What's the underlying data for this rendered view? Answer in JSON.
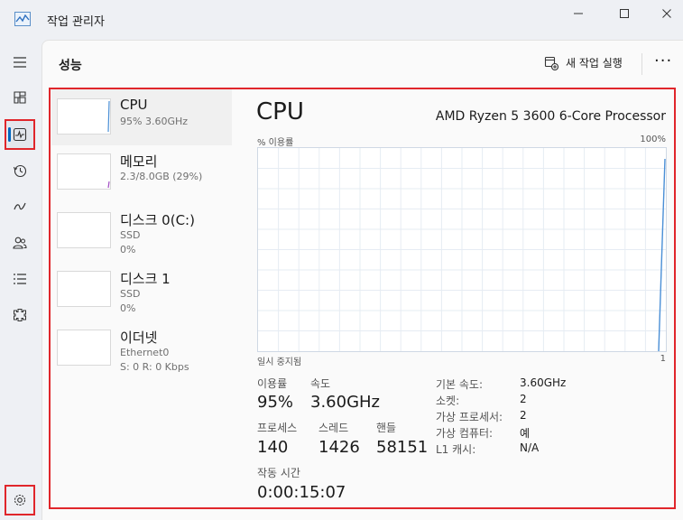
{
  "window": {
    "title": "작업 관리자"
  },
  "page": {
    "title": "성능",
    "run_task_label": "새 작업 실행"
  },
  "nav": [
    "menu-icon",
    "processes-icon",
    "performance-icon",
    "app-history-icon",
    "startup-icon",
    "users-icon",
    "details-icon",
    "services-icon",
    "settings-icon"
  ],
  "list": [
    {
      "title": "CPU",
      "sub1": "95% 3.60GHz",
      "sub2": ""
    },
    {
      "title": "메모리",
      "sub1": "2.3/8.0GB (29%)",
      "sub2": ""
    },
    {
      "title": "디스크 0(C:)",
      "sub1": "SSD",
      "sub2": "0%"
    },
    {
      "title": "디스크 1",
      "sub1": "SSD",
      "sub2": "0%"
    },
    {
      "title": "이더넷",
      "sub1": "Ethernet0",
      "sub2": "S: 0 R: 0 Kbps"
    }
  ],
  "detail": {
    "title": "CPU",
    "model": "AMD Ryzen 5 3600 6-Core Processor",
    "axis_top_left": "% 이용률",
    "axis_top_right": "100%",
    "axis_bottom_left": "일시 중지됨",
    "axis_bottom_right": "1",
    "stats": {
      "utilization_label": "이용률",
      "utilization": "95%",
      "speed_label": "속도",
      "speed": "3.60GHz",
      "processes_label": "프로세스",
      "processes": "140",
      "threads_label": "스레드",
      "threads": "1426",
      "handles_label": "핸들",
      "handles": "58151",
      "uptime_label": "작동 시간",
      "uptime": "0:00:15:07"
    },
    "kv": [
      {
        "label": "기본 속도:",
        "value": "3.60GHz"
      },
      {
        "label": "소켓:",
        "value": "2"
      },
      {
        "label": "가상 프로세서:",
        "value": "2"
      },
      {
        "label": "가상 컴퓨터:",
        "value": "예"
      },
      {
        "label": "L1 캐시:",
        "value": "N/A"
      }
    ]
  },
  "colors": {
    "accent": "#0067c0",
    "highlight": "#e0262b",
    "cpu_line": "#4a8fd6",
    "memory_line": "#a24fc4"
  }
}
